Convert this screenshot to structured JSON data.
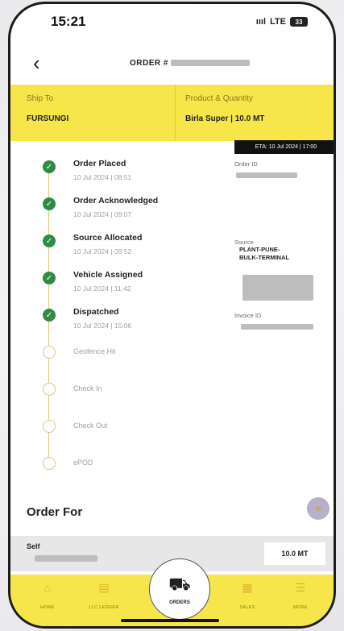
{
  "status_bar": {
    "time": "15:21",
    "signal": "ıııl",
    "network": "LTE",
    "battery": "33"
  },
  "header": {
    "back_icon": "chevron-left-icon",
    "title": "ORDER #"
  },
  "shipment": {
    "ship_to_label": "Ship To",
    "ship_to_value": "FURSUNGI",
    "product_label": "Product & Quantity",
    "product_value": "Birla Super | 10.0 MT"
  },
  "eta": "ETA: 10 Jul 2024 | 17:00",
  "timeline": [
    {
      "title": "Order Placed",
      "date": "10 Jul 2024 | 08:51",
      "done": true
    },
    {
      "title": "Order Acknowledged",
      "date": "10 Jul 2024 | 09:07",
      "done": true
    },
    {
      "title": "Source Allocated",
      "date": "10 Jul 2024 | 09:52",
      "done": true
    },
    {
      "title": "Vehicle Assigned",
      "date": "10 Jul 2024 | 11:42",
      "done": true
    },
    {
      "title": "Dispatched",
      "date": "10 Jul 2024 | 15:06",
      "done": true
    },
    {
      "title": "Geofence Hit",
      "date": "",
      "done": false
    },
    {
      "title": "Check In",
      "date": "",
      "done": false
    },
    {
      "title": "Check Out",
      "date": "",
      "done": false
    },
    {
      "title": "ePOD",
      "date": "",
      "done": false
    }
  ],
  "details": {
    "order_id_label": "Order ID",
    "source_label": "Source",
    "source_line1": "PLANT-PUNE-",
    "source_line2": "BULK-TERMINAL",
    "invoice_label": "Invoice ID"
  },
  "order_for": {
    "title": "Order For",
    "name": "Self",
    "quantity": "10.0 MT"
  },
  "bottom_nav": {
    "items": [
      {
        "label": "HOME",
        "icon": "home-icon"
      },
      {
        "label": "LLC LEDGER",
        "icon": "ledger-icon"
      },
      {
        "label": "ORDERS",
        "icon": "truck-icon"
      },
      {
        "label": "SALES",
        "icon": "sales-icon"
      },
      {
        "label": "MORE",
        "icon": "more-icon"
      }
    ]
  },
  "colors": {
    "accent_yellow": "#f6e64a",
    "success_green": "#2e8b46",
    "eta_bg": "#111111"
  }
}
